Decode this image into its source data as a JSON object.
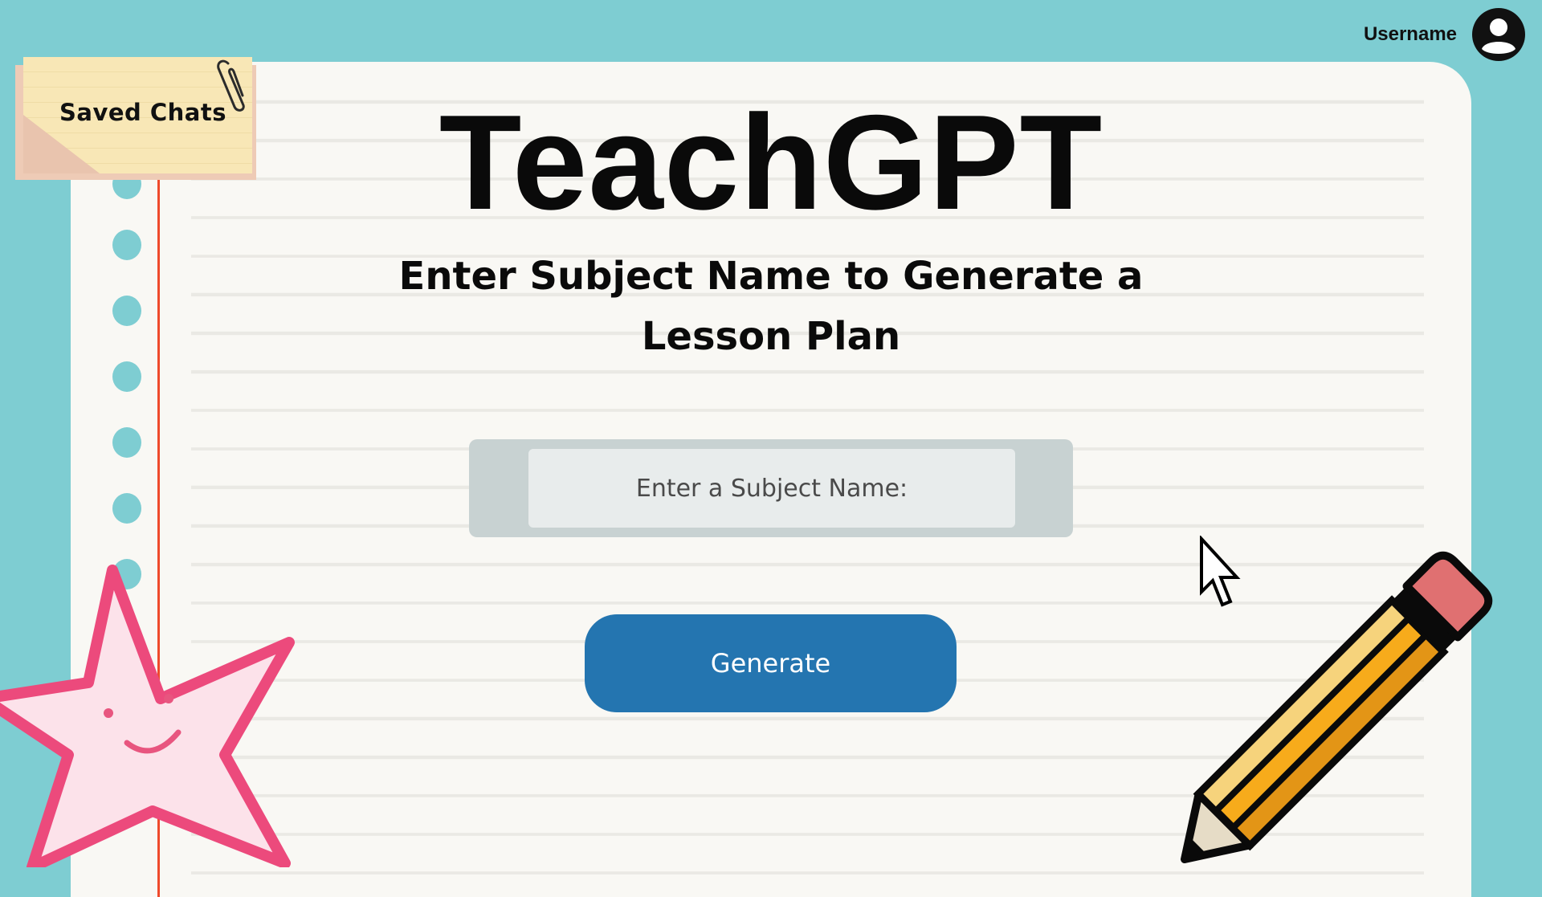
{
  "header": {
    "username": "Username"
  },
  "sidebar": {
    "saved_chats_label": "Saved Chats"
  },
  "main": {
    "title": "TeachGPT",
    "subtitle": "Enter Subject Name to Generate a Lesson Plan",
    "subject_input": {
      "placeholder": "Enter a Subject Name:",
      "value": ""
    },
    "generate_label": "Generate"
  },
  "icons": {
    "avatar": "user-circle-icon",
    "paperclip": "paperclip-icon",
    "cursor": "mouse-pointer-icon",
    "star": "star-sticker",
    "pencil": "pencil-illustration"
  },
  "colors": {
    "background": "#7ecdd2",
    "paper": "#f9f8f4",
    "margin_line": "#ef4a2c",
    "generate_button": "#2475b0",
    "input_frame": "#c8d2d2",
    "note": "#f8e7b6",
    "star_outline": "#ec4a7c",
    "pencil_body": "#f7ab1b"
  }
}
